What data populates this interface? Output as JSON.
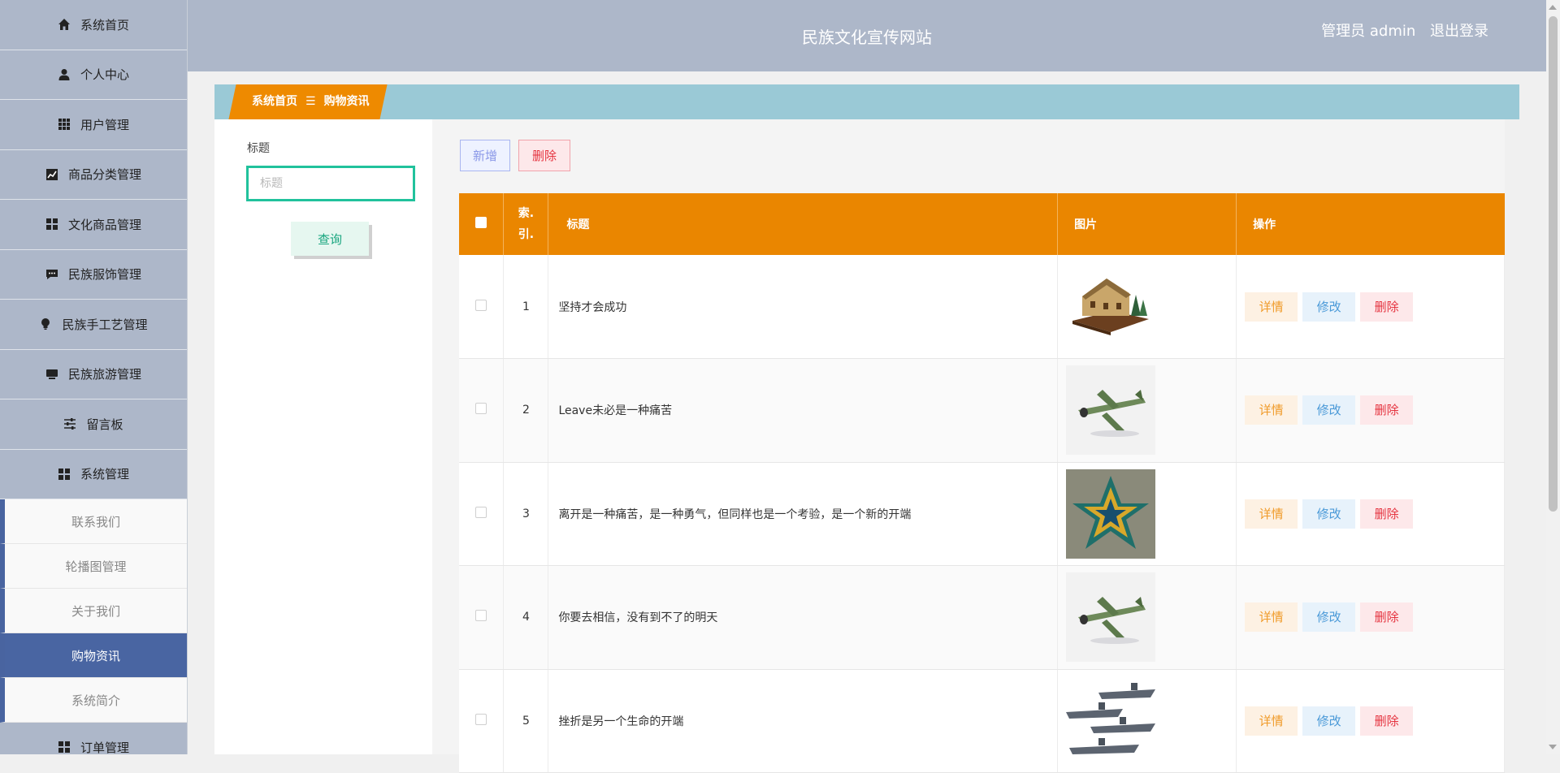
{
  "header": {
    "title": "民族文化宣传网站",
    "user_label": "管理员 admin",
    "logout": "退出登录"
  },
  "sidebar": {
    "items": [
      {
        "label": "系统首页",
        "icon": "home-icon"
      },
      {
        "label": "个人中心",
        "icon": "user-icon"
      },
      {
        "label": "用户管理",
        "icon": "grid-icon"
      },
      {
        "label": "商品分类管理",
        "icon": "chart-icon"
      },
      {
        "label": "文化商品管理",
        "icon": "apps-icon"
      },
      {
        "label": "民族服饰管理",
        "icon": "chat-icon"
      },
      {
        "label": "民族手工艺管理",
        "icon": "bulb-icon"
      },
      {
        "label": "民族旅游管理",
        "icon": "monitor-icon"
      },
      {
        "label": "留言板",
        "icon": "sliders-icon"
      },
      {
        "label": "系统管理",
        "icon": "apps-icon"
      }
    ],
    "submenu": [
      {
        "label": "联系我们"
      },
      {
        "label": "轮播图管理"
      },
      {
        "label": "关于我们"
      },
      {
        "label": "购物资讯",
        "active": true
      },
      {
        "label": "系统简介"
      }
    ],
    "last_item": {
      "label": "订单管理",
      "icon": "apps-icon"
    }
  },
  "breadcrumb": {
    "home": "系统首页",
    "separator": "☰",
    "current": "购物资讯"
  },
  "search": {
    "label": "标题",
    "placeholder": "标题",
    "value": "",
    "button": "查询"
  },
  "toolbar": {
    "add": "新增",
    "delete": "删除"
  },
  "table": {
    "headers": {
      "index_line1": "索.",
      "index_line2": "引.",
      "title": "标题",
      "image": "图片",
      "ops": "操作"
    },
    "rows": [
      {
        "index": "1",
        "title": "坚持才会成功",
        "image": "house-model"
      },
      {
        "index": "2",
        "title": "Leave未必是一种痛苦",
        "image": "airplane-model"
      },
      {
        "index": "3",
        "title": "离开是一种痛苦，是一种勇气，但同样也是一个考验，是一个新的开端",
        "image": "star-puzzle"
      },
      {
        "index": "4",
        "title": "你要去相信，没有到不了的明天",
        "image": "airplane-model"
      },
      {
        "index": "5",
        "title": "挫折是另一个生命的开端",
        "image": "ships-model"
      }
    ],
    "ops": {
      "detail": "详情",
      "edit": "修改",
      "delete": "删除"
    }
  },
  "colors": {
    "accent_orange": "#ea8600",
    "sidebar_bg": "#adb7c9",
    "active_blue": "#4965a2",
    "search_border": "#21c29c"
  }
}
